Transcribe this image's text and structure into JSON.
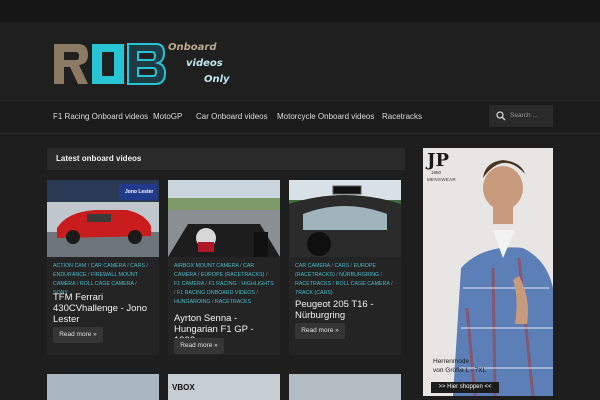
{
  "logo": {
    "line1": "Onboard",
    "line2": "videos",
    "line3": "Only"
  },
  "nav": {
    "items": [
      "F1 Racing Onboard videos",
      "MotoGP",
      "Car Onboard videos",
      "Motorcycle Onboard videos",
      "Racetracks"
    ]
  },
  "search": {
    "placeholder": "Search ..."
  },
  "section": {
    "title": "Latest onboard videos"
  },
  "cards": [
    {
      "tags": [
        "ACTION CAM",
        "CAR CAMERA",
        "CARS",
        "ENDURANCE",
        "FIREWALL MOUNT CAMERA",
        "ROLL CAGE CAMERA",
        "SONY"
      ],
      "title": "TFM Ferrari 430CVhallenge - Jono Lester",
      "button": "Read more »"
    },
    {
      "tags": [
        "AIRBOX MOUNT CAMERA",
        "CAR CAMERA",
        "EUROPE (RACETRACKS)",
        "F1 CAMERA",
        "F1 RACING - HIGHLIGHTS",
        "F1 RACING ONBOARD VIDEOS",
        "HUNGAROING",
        "RACETRACKS"
      ],
      "title": "Ayrton Senna - Hungarian F1 GP - 1992",
      "button": "Read more »"
    },
    {
      "tags": [
        "CAR CAMERA",
        "CARS",
        "EUROPE (RACETRACKS)",
        "NÜRBURGRING",
        "RACETRACKS",
        "ROLL CAGE CAMERA",
        "TRACK (CARS)"
      ],
      "title": "Peugeot 205 T16 - Nürburgring",
      "button": "Read more »"
    }
  ],
  "thumbs": {
    "card1_overlay": "Jono Lester",
    "card2_next": "VBOX"
  },
  "ad": {
    "brand_mark": "JP",
    "year": "1880",
    "brand_name": "MENSWEAR",
    "line1": "Herrenmode",
    "line2": "von Größe L - 7XL",
    "cta": ">> Hier shoppen <<"
  },
  "colors": {
    "accent_tag": "#4ab8c7",
    "background": "#1e1e1e",
    "logo_cyan": "#28c3d4",
    "logo_tan": "#8c7a64"
  }
}
